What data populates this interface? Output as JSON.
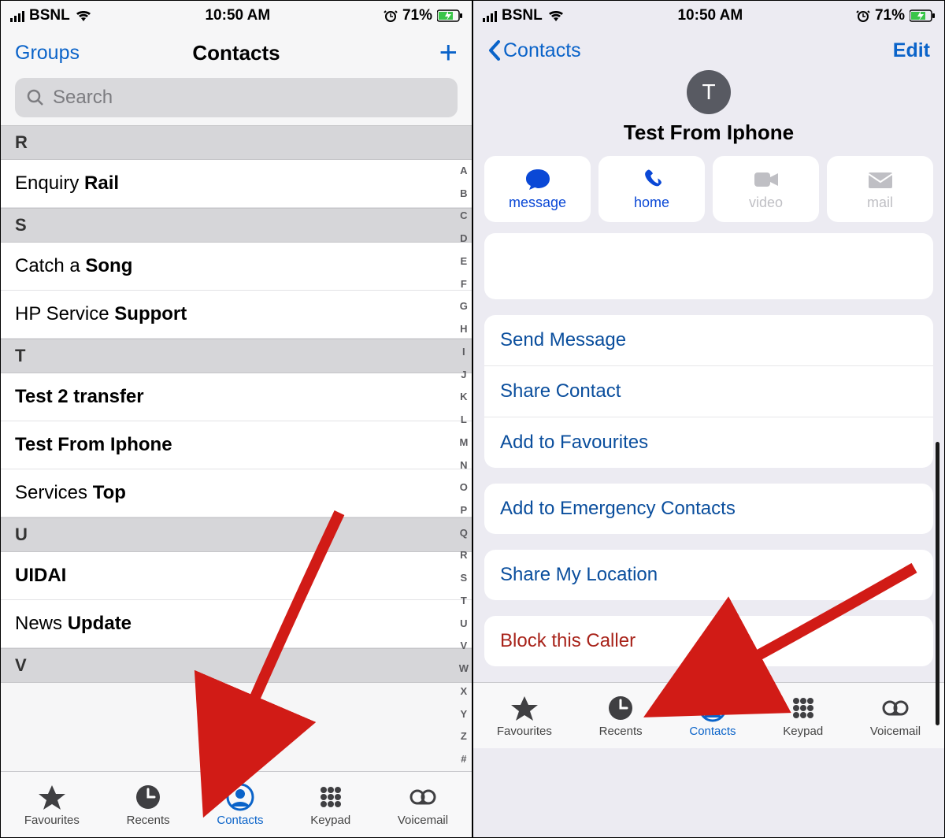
{
  "status": {
    "carrier": "BSNL",
    "time": "10:50 AM",
    "battery": "71%"
  },
  "left_screen": {
    "nav": {
      "left": "Groups",
      "title": "Contacts",
      "add": "+"
    },
    "search_placeholder": "Search",
    "sections": [
      {
        "letter": "R",
        "rows": [
          {
            "pre": "Enquiry ",
            "bold": "Rail"
          }
        ]
      },
      {
        "letter": "S",
        "rows": [
          {
            "pre": "Catch a ",
            "bold": "Song"
          },
          {
            "pre": "HP Service ",
            "bold": "Support"
          }
        ]
      },
      {
        "letter": "T",
        "rows": [
          {
            "pre": "",
            "bold": "Test 2 transfer"
          },
          {
            "pre": "",
            "bold": "Test From Iphone"
          },
          {
            "pre": "Services ",
            "bold": "Top"
          }
        ]
      },
      {
        "letter": "U",
        "rows": [
          {
            "pre": "",
            "bold": "UIDAI"
          },
          {
            "pre": "News ",
            "bold": "Update"
          }
        ]
      },
      {
        "letter": "V",
        "rows": []
      }
    ],
    "index": [
      "A",
      "B",
      "C",
      "D",
      "E",
      "F",
      "G",
      "H",
      "I",
      "J",
      "K",
      "L",
      "M",
      "N",
      "O",
      "P",
      "Q",
      "R",
      "S",
      "T",
      "U",
      "V",
      "W",
      "X",
      "Y",
      "Z",
      "#"
    ]
  },
  "right_screen": {
    "nav": {
      "back": "Contacts",
      "edit": "Edit"
    },
    "contact": {
      "initial": "T",
      "name": "Test From Iphone"
    },
    "actions": [
      {
        "key": "message",
        "label": "message",
        "active": true
      },
      {
        "key": "home",
        "label": "home",
        "active": true
      },
      {
        "key": "video",
        "label": "video",
        "active": false
      },
      {
        "key": "mail",
        "label": "mail",
        "active": false
      }
    ],
    "groups": [
      {
        "rows": [
          {
            "label": "Send Message"
          },
          {
            "label": "Share Contact"
          },
          {
            "label": "Add to Favourites"
          }
        ]
      },
      {
        "rows": [
          {
            "label": "Add to Emergency Contacts"
          }
        ]
      },
      {
        "rows": [
          {
            "label": "Share My Location"
          }
        ]
      },
      {
        "rows": [
          {
            "label": "Block this Caller",
            "danger": true
          }
        ]
      }
    ]
  },
  "tabs": [
    {
      "key": "favourites",
      "label": "Favourites"
    },
    {
      "key": "recents",
      "label": "Recents"
    },
    {
      "key": "contacts",
      "label": "Contacts",
      "active": true
    },
    {
      "key": "keypad",
      "label": "Keypad"
    },
    {
      "key": "voicemail",
      "label": "Voicemail"
    }
  ]
}
